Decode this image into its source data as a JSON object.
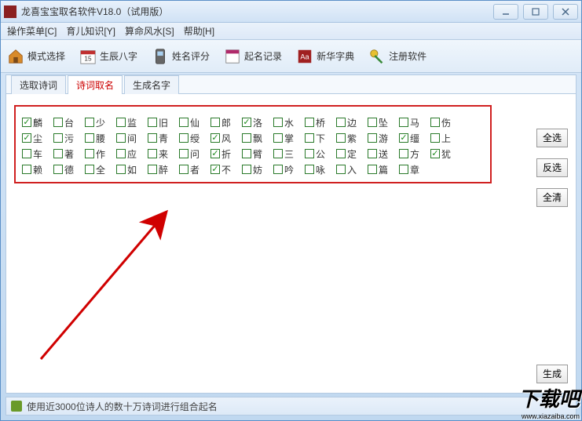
{
  "window": {
    "title": "龙喜宝宝取名软件V18.0（试用版）"
  },
  "menubar": {
    "items": [
      "操作菜单[C]",
      "育儿知识[Y]",
      "算命风水[S]",
      "帮助[H]"
    ]
  },
  "toolbar": {
    "items": [
      {
        "label": "模式选择",
        "icon": "home-icon"
      },
      {
        "label": "生辰八字",
        "icon": "calendar-icon"
      },
      {
        "label": "姓名评分",
        "icon": "phone-icon"
      },
      {
        "label": "起名记录",
        "icon": "record-icon"
      },
      {
        "label": "新华字典",
        "icon": "dict-icon"
      },
      {
        "label": "注册软件",
        "icon": "register-icon"
      }
    ]
  },
  "tabs": {
    "items": [
      "选取诗词",
      "诗词取名",
      "生成名字"
    ],
    "active_index": 1
  },
  "characters": [
    {
      "char": "麟",
      "checked": true
    },
    {
      "char": "台",
      "checked": false
    },
    {
      "char": "少",
      "checked": false
    },
    {
      "char": "监",
      "checked": false
    },
    {
      "char": "旧",
      "checked": false
    },
    {
      "char": "仙",
      "checked": false
    },
    {
      "char": "郎",
      "checked": false
    },
    {
      "char": "洛",
      "checked": true
    },
    {
      "char": "水",
      "checked": false
    },
    {
      "char": "桥",
      "checked": false
    },
    {
      "char": "边",
      "checked": false
    },
    {
      "char": "坠",
      "checked": false
    },
    {
      "char": "马",
      "checked": false
    },
    {
      "char": "伤",
      "checked": false
    },
    {
      "char": "尘",
      "checked": true
    },
    {
      "char": "污",
      "checked": false
    },
    {
      "char": "腰",
      "checked": false
    },
    {
      "char": "间",
      "checked": false
    },
    {
      "char": "青",
      "checked": false
    },
    {
      "char": "绶",
      "checked": false
    },
    {
      "char": "风",
      "checked": true
    },
    {
      "char": "飘",
      "checked": false
    },
    {
      "char": "掌",
      "checked": false
    },
    {
      "char": "下",
      "checked": false
    },
    {
      "char": "紫",
      "checked": false
    },
    {
      "char": "游",
      "checked": false
    },
    {
      "char": "缰",
      "checked": true
    },
    {
      "char": "上",
      "checked": false
    },
    {
      "char": "车",
      "checked": false
    },
    {
      "char": "著",
      "checked": false
    },
    {
      "char": "作",
      "checked": false
    },
    {
      "char": "应",
      "checked": false
    },
    {
      "char": "来",
      "checked": false
    },
    {
      "char": "问",
      "checked": false
    },
    {
      "char": "折",
      "checked": true
    },
    {
      "char": "臂",
      "checked": false
    },
    {
      "char": "三",
      "checked": false
    },
    {
      "char": "公",
      "checked": false
    },
    {
      "char": "定",
      "checked": false
    },
    {
      "char": "送",
      "checked": false
    },
    {
      "char": "方",
      "checked": false
    },
    {
      "char": "犹",
      "checked": true
    },
    {
      "char": "赖",
      "checked": false
    },
    {
      "char": "德",
      "checked": false
    },
    {
      "char": "全",
      "checked": false
    },
    {
      "char": "如",
      "checked": false
    },
    {
      "char": "醉",
      "checked": false
    },
    {
      "char": "者",
      "checked": false
    },
    {
      "char": "不",
      "checked": true
    },
    {
      "char": "妨",
      "checked": false
    },
    {
      "char": "吟",
      "checked": false
    },
    {
      "char": "咏",
      "checked": false
    },
    {
      "char": "入",
      "checked": false
    },
    {
      "char": "篇",
      "checked": false
    },
    {
      "char": "章",
      "checked": false
    }
  ],
  "side_buttons": {
    "select_all": "全选",
    "invert": "反选",
    "clear_all": "全清",
    "generate": "生成"
  },
  "statusbar": {
    "text": "使用近3000位诗人的数十万诗词进行组合起名"
  },
  "watermark": {
    "text": "下载吧",
    "url": "www.xiazaiba.com"
  }
}
